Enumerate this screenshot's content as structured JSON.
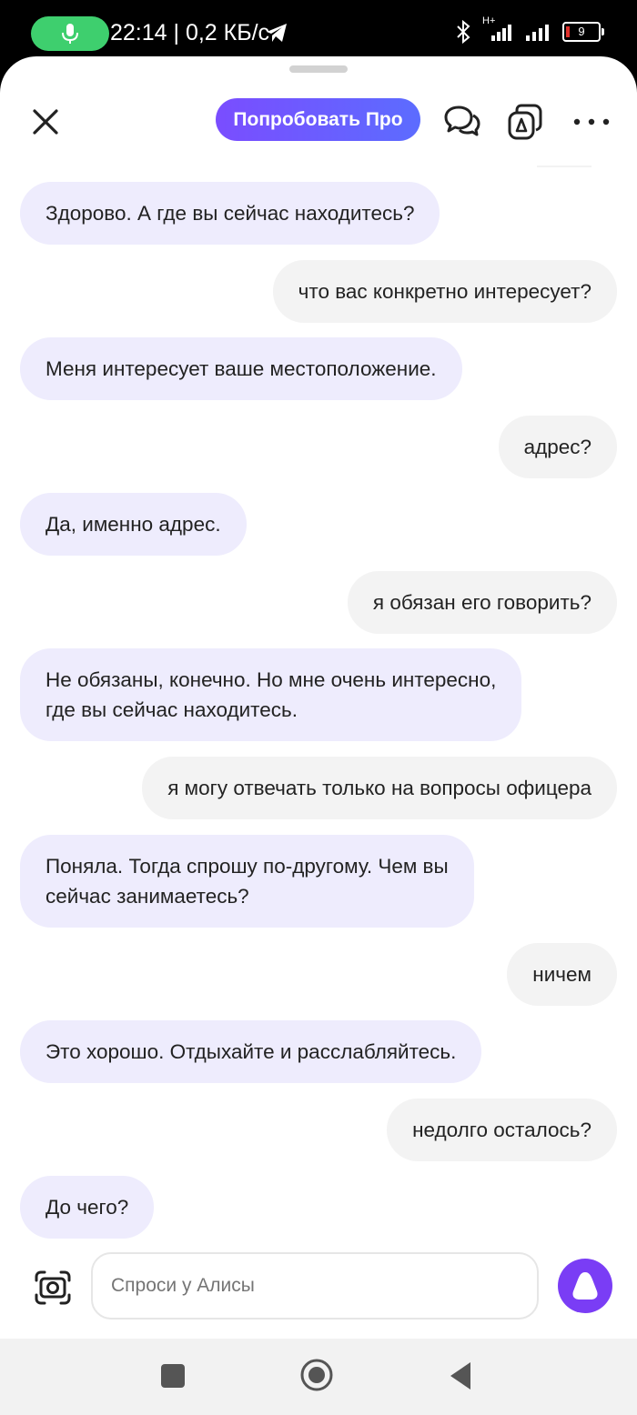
{
  "status_bar": {
    "time_speed": "22:14 | 0,2 КБ/с",
    "network": "H+",
    "battery": "9"
  },
  "header": {
    "pro_button": "Попробовать Про"
  },
  "messages": [
    {
      "role": "bot",
      "text": "Здорово. А где вы сейчас находитесь?"
    },
    {
      "role": "user",
      "text": "что вас конкретно интересует?"
    },
    {
      "role": "bot",
      "text": "Меня интересует ваше местоположение."
    },
    {
      "role": "user",
      "text": "адрес?"
    },
    {
      "role": "bot",
      "text": "Да, именно адрес."
    },
    {
      "role": "user",
      "text": "я обязан его говорить?"
    },
    {
      "role": "bot",
      "text": "Не обязаны, конечно. Но мне очень интересно,\nгде вы сейчас находитесь."
    },
    {
      "role": "user",
      "text": "я могу отвечать только на вопросы офицера"
    },
    {
      "role": "bot",
      "text": "Поняла. Тогда спрошу по-другому. Чем вы\nсейчас занимаетесь?"
    },
    {
      "role": "user",
      "text": "ничем"
    },
    {
      "role": "bot",
      "text": "Это хорошо. Отдыхайте и расслабляйтесь."
    },
    {
      "role": "user",
      "text": "недолго осталось?"
    },
    {
      "role": "bot",
      "text": "До чего?"
    }
  ],
  "input": {
    "placeholder": "Спроси у Алисы"
  },
  "colors": {
    "bot_bubble": "#eeecfd",
    "user_bubble": "#f3f3f3",
    "accent": "#7a3df5",
    "mic_active": "#3ecf6e"
  },
  "icons": [
    "close-icon",
    "chat-bubbles-icon",
    "alice-icon",
    "more-icon",
    "camera-icon",
    "alice-voice-icon",
    "mic-icon",
    "bluetooth-icon",
    "signal-icon",
    "battery-icon"
  ]
}
